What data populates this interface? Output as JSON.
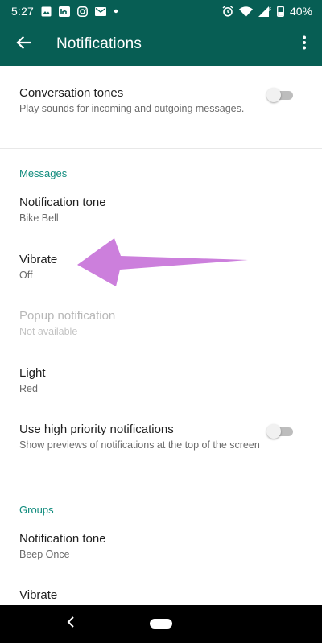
{
  "status_bar": {
    "time": "5:27",
    "battery_percent": "40%",
    "left_icons": [
      "image-icon",
      "linkedin-icon",
      "instagram-icon",
      "mail-icon",
      "dot-icon"
    ],
    "right_icons": [
      "alarm-icon",
      "wifi-icon",
      "signal-icon",
      "battery-icon"
    ],
    "signal_label": "R"
  },
  "app_bar": {
    "title": "Notifications",
    "back_icon": "arrow-back-icon",
    "more_icon": "more-vert-icon"
  },
  "colors": {
    "primary": "#075e54",
    "accent": "#128c7e",
    "annotation_arrow": "#cc7fdc"
  },
  "general": {
    "conversation_tones": {
      "title": "Conversation tones",
      "subtitle": "Play sounds for incoming and outgoing messages.",
      "enabled": false
    }
  },
  "messages": {
    "header": "Messages",
    "notification_tone": {
      "title": "Notification tone",
      "value": "Bike Bell"
    },
    "vibrate": {
      "title": "Vibrate",
      "value": "Off"
    },
    "popup_notification": {
      "title": "Popup notification",
      "value": "Not available"
    },
    "light": {
      "title": "Light",
      "value": "Red"
    },
    "high_priority": {
      "title": "Use high priority notifications",
      "subtitle": "Show previews of notifications at the top of the screen",
      "enabled": false
    }
  },
  "groups": {
    "header": "Groups",
    "notification_tone": {
      "title": "Notification tone",
      "value": "Beep Once"
    },
    "vibrate": {
      "title": "Vibrate"
    }
  },
  "nav_bar": {
    "back_icon": "nav-back-icon",
    "home_icon": "nav-home-pill-icon"
  }
}
